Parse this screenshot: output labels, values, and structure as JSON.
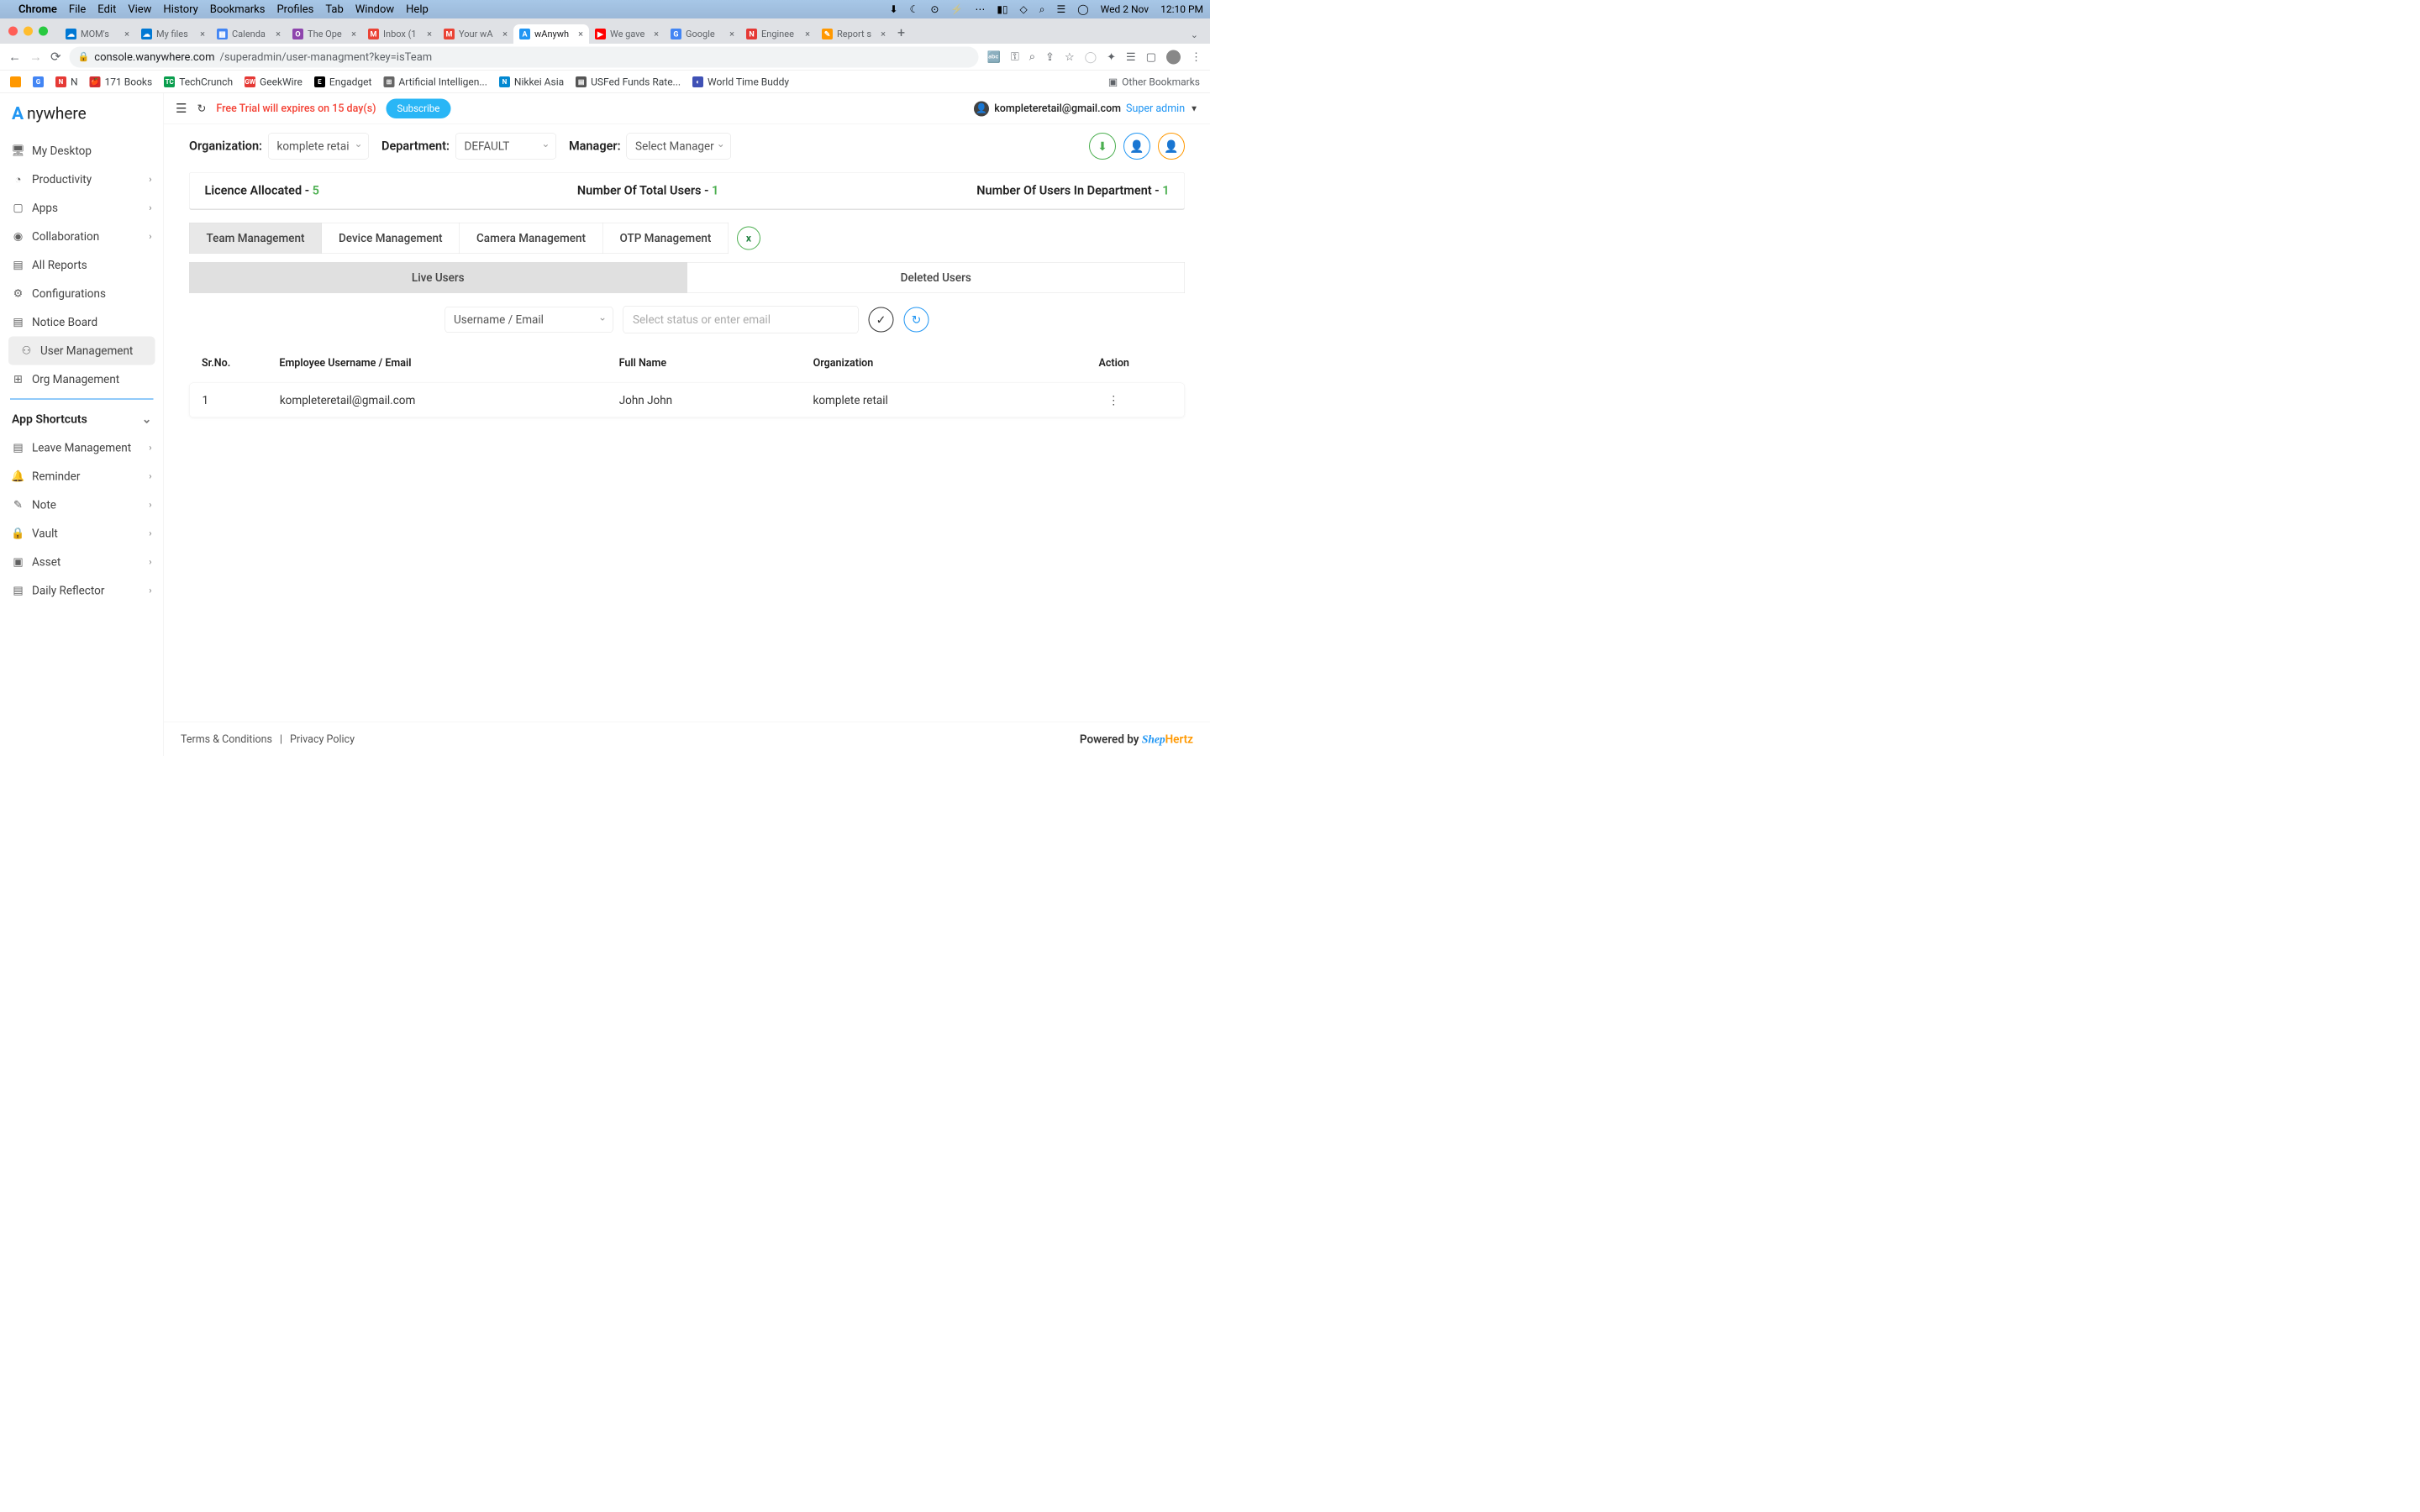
{
  "mac": {
    "app": "Chrome",
    "menus": [
      "File",
      "Edit",
      "View",
      "History",
      "Bookmarks",
      "Profiles",
      "Tab",
      "Window",
      "Help"
    ],
    "date": "Wed 2 Nov",
    "time": "12:10 PM"
  },
  "browser": {
    "tabs": [
      {
        "title": "MOM's",
        "fav": "☁",
        "favbg": "#0078d4"
      },
      {
        "title": "My files",
        "fav": "☁",
        "favbg": "#0078d4"
      },
      {
        "title": "Calenda",
        "fav": "▦",
        "favbg": "#4285f4"
      },
      {
        "title": "The Ope",
        "fav": "O",
        "favbg": "#8e44ad"
      },
      {
        "title": "Inbox (1",
        "fav": "M",
        "favbg": "#ea4335"
      },
      {
        "title": "Your wA",
        "fav": "M",
        "favbg": "#ea4335"
      },
      {
        "title": "wAnywh",
        "fav": "A",
        "favbg": "#2196f3",
        "active": true
      },
      {
        "title": "We gave",
        "fav": "▶",
        "favbg": "#ff0000"
      },
      {
        "title": "Google",
        "fav": "G",
        "favbg": "#4285f4"
      },
      {
        "title": "Enginee",
        "fav": "N",
        "favbg": "#e53935"
      },
      {
        "title": "Report s",
        "fav": "✎",
        "favbg": "#ff9800"
      }
    ],
    "url_host": "console.wanywhere.com",
    "url_path": "/superadmin/user-managment?key=isTeam",
    "bookmarks": [
      {
        "t": "",
        "bg": "#ff9800",
        "txt": ""
      },
      {
        "t": "",
        "bg": "#4285f4",
        "txt": "G"
      },
      {
        "t": "N",
        "bg": "#e53935",
        "txt": "N"
      },
      {
        "t": "171 Books",
        "bg": "#d32f2f",
        "txt": "🍎"
      },
      {
        "t": "TechCrunch",
        "bg": "#0a9e4e",
        "txt": "TC"
      },
      {
        "t": "GeekWire",
        "bg": "#e53935",
        "txt": "GW"
      },
      {
        "t": "Engadget",
        "bg": "#000",
        "txt": "E"
      },
      {
        "t": "Artificial Intelligen...",
        "bg": "#666",
        "txt": "⊞"
      },
      {
        "t": "Nikkei Asia",
        "bg": "#0288d1",
        "txt": "N"
      },
      {
        "t": "USFed Funds Rate...",
        "bg": "#555",
        "txt": "▤"
      },
      {
        "t": "World Time Buddy",
        "bg": "#3f51b5",
        "txt": "◐"
      }
    ],
    "other_bm": "Other Bookmarks"
  },
  "sidebar": {
    "logo": "nywhere",
    "items": [
      {
        "icon": "🖥",
        "label": "My Desktop"
      },
      {
        "icon": "◔",
        "label": "Productivity",
        "chev": true
      },
      {
        "icon": "▢",
        "label": "Apps",
        "chev": true
      },
      {
        "icon": "◉",
        "label": "Collaboration",
        "chev": true
      },
      {
        "icon": "▤",
        "label": "All Reports"
      },
      {
        "icon": "⚙",
        "label": "Configurations"
      },
      {
        "icon": "▤",
        "label": "Notice Board"
      },
      {
        "icon": "⚇",
        "label": "User Management",
        "active": true
      },
      {
        "icon": "⊞",
        "label": "Org Management"
      }
    ],
    "shortcuts_head": "App Shortcuts",
    "shortcuts": [
      {
        "icon": "▤",
        "label": "Leave Management",
        "chev": true
      },
      {
        "icon": "🔔",
        "label": "Reminder",
        "chev": true
      },
      {
        "icon": "✎",
        "label": "Note",
        "chev": true
      },
      {
        "icon": "🔒",
        "label": "Vault",
        "chev": true
      },
      {
        "icon": "▣",
        "label": "Asset",
        "chev": true
      },
      {
        "icon": "▤",
        "label": "Daily Reflector",
        "chev": true
      }
    ]
  },
  "topbar": {
    "trial": "Free Trial will expires on 15 day(s)",
    "subscribe": "Subscribe",
    "email": "kompleteretail@gmail.com",
    "role": "Super admin"
  },
  "filters": {
    "org_label": "Organization:",
    "org_value": "komplete retai",
    "dept_label": "Department:",
    "dept_value": "DEFAULT",
    "mgr_label": "Manager:",
    "mgr_value": "Select Manager"
  },
  "stats": {
    "lic": "Licence Allocated - ",
    "lic_n": "5",
    "tot": "Number Of Total Users - ",
    "tot_n": "1",
    "dep": "Number Of Users In Department - ",
    "dep_n": "1"
  },
  "mgmt_tabs": [
    "Team Management",
    "Device Management",
    "Camera Management",
    "OTP Management"
  ],
  "sub_tabs": [
    "Live Users",
    "Deleted Users"
  ],
  "search": {
    "field": "Username / Email",
    "placeholder": "Select status or enter email"
  },
  "table": {
    "headers": [
      "Sr.No.",
      "Employee Username / Email",
      "Full Name",
      "Organization",
      "Action"
    ],
    "rows": [
      {
        "n": "1",
        "email": "kompleteretail@gmail.com",
        "name": "John John",
        "org": "komplete retail"
      }
    ]
  },
  "footer": {
    "tc": "Terms & Conditions",
    "pp": "Privacy Policy",
    "pby": "Powered by",
    "brand1": "Shep",
    "brand2": "Hertz"
  }
}
